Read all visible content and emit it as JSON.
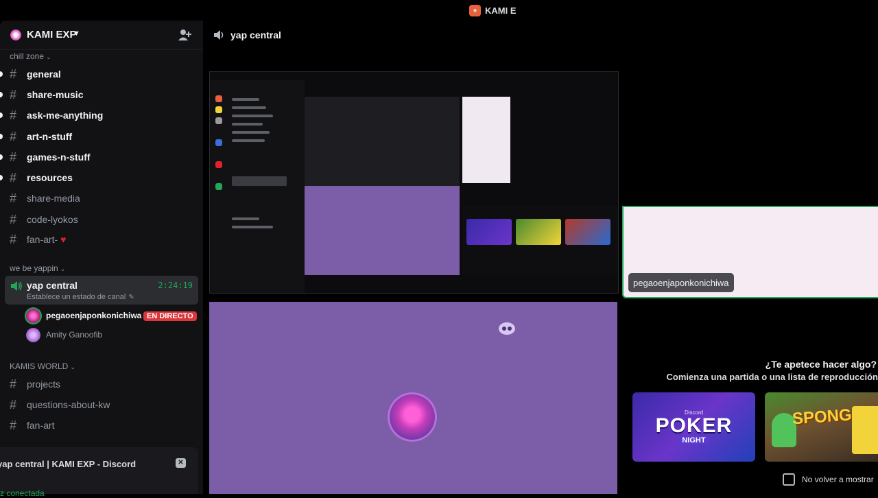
{
  "top_bar": {
    "app_name": "KAMI E"
  },
  "server": {
    "name": "KAMI EXP"
  },
  "categories": [
    {
      "label": "chill zone"
    },
    {
      "label": "we be yappin"
    },
    {
      "label": "KAMIS WORLD"
    }
  ],
  "channels_chill": [
    {
      "name": "general",
      "unread": true
    },
    {
      "name": "share-music",
      "unread": true
    },
    {
      "name": "ask-me-anything",
      "unread": true
    },
    {
      "name": "art-n-stuff",
      "unread": true
    },
    {
      "name": "games-n-stuff",
      "unread": true
    },
    {
      "name": "resources",
      "unread": true
    },
    {
      "name": "share-media",
      "unread": false
    },
    {
      "name": "code-lyokos",
      "unread": false
    },
    {
      "name": "fan-art-",
      "unread": false
    }
  ],
  "voice_channel": {
    "name": "yap central",
    "timer": "2:24:19",
    "status": "Establece un estado de canal",
    "users": [
      {
        "name": "pegaoenjaponkonichiwa",
        "live": "EN DIRECTO"
      },
      {
        "name": "Amity Ganoofib"
      }
    ]
  },
  "channels_world": [
    {
      "name": "projects"
    },
    {
      "name": "questions-about-kw"
    },
    {
      "name": "fan-art"
    }
  ],
  "rtc_panel": {
    "title": "yap central | KAMI EXP - Discord",
    "status": "z conectada"
  },
  "main": {
    "channel_title": "yap central",
    "stream_label": "pegaoenjaponkonichiwa",
    "pink_tile_label": "pegaoenjaponkonichiwa"
  },
  "activity": {
    "question": "¿Te apetece hacer algo?",
    "subtitle": "Comienza una partida o una lista de reproducción",
    "card_poker": {
      "brand": "Discord",
      "title": "POKER",
      "tag": "NIGHT"
    },
    "card_sponge": {
      "title": "SPONGEBOB"
    },
    "checkbox_label": "No volver a mostrar"
  },
  "colors": {
    "accent_green": "#23a55a",
    "live_red": "#da373c",
    "tile_purple": "#7b5ea7",
    "sidebar_bg": "#121214"
  }
}
